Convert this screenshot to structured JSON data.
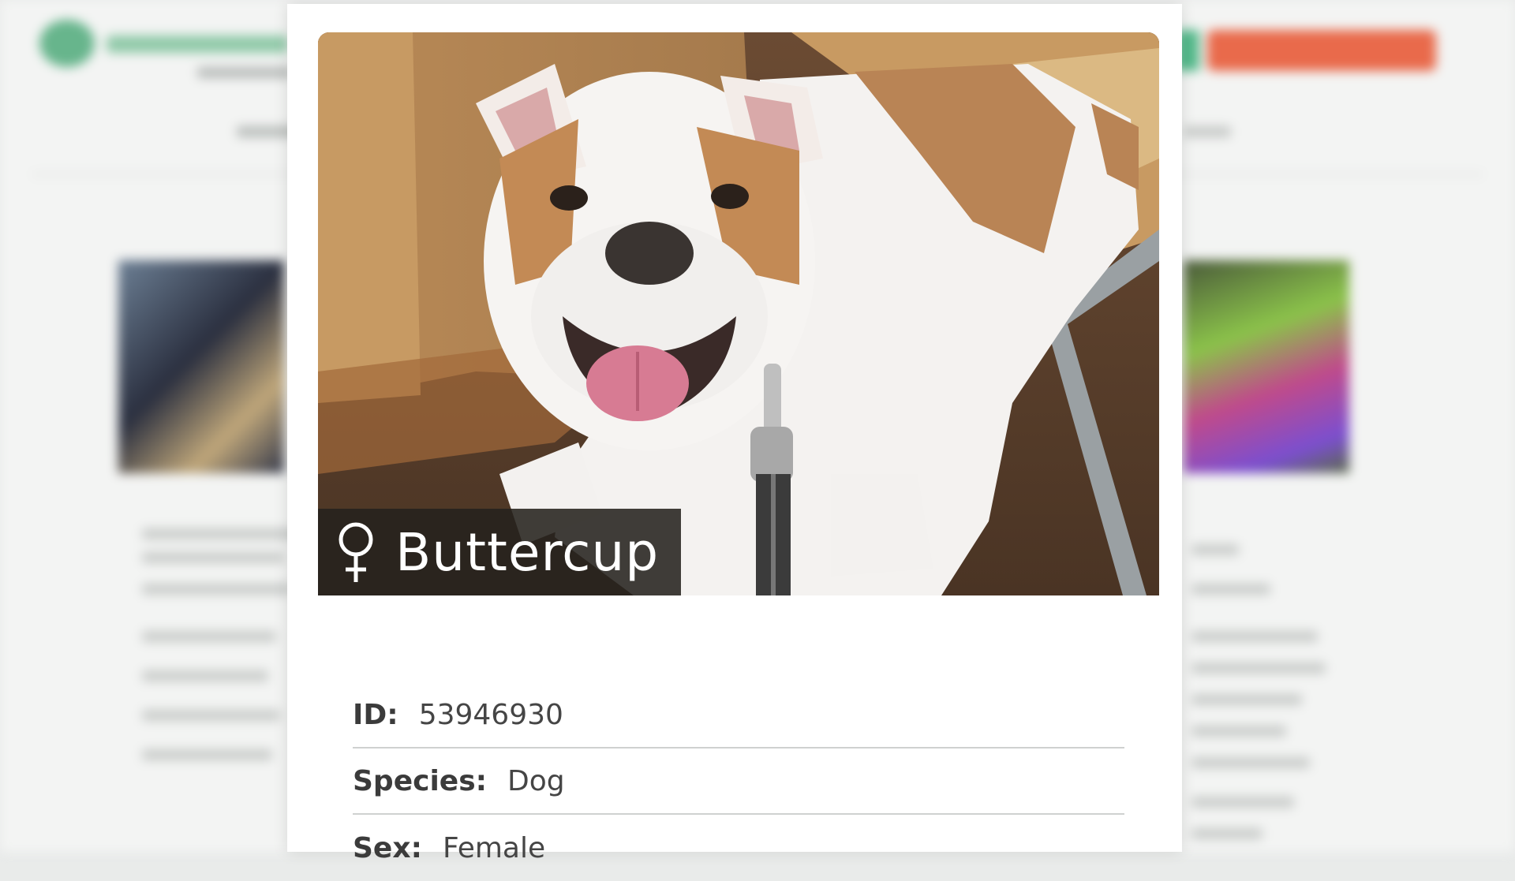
{
  "pet": {
    "name": "Buttercup",
    "sex_icon": "female-symbol-icon",
    "photo_subject": "bulldog"
  },
  "details": [
    {
      "label": "ID:",
      "value": "53946930"
    },
    {
      "label": "Species:",
      "value": "Dog"
    },
    {
      "label": "Sex:",
      "value": "Female"
    }
  ],
  "colors": {
    "name_banner_bg": "#26221e",
    "background_accent_green": "#54b98a",
    "background_accent_orange": "#e96a4b"
  }
}
